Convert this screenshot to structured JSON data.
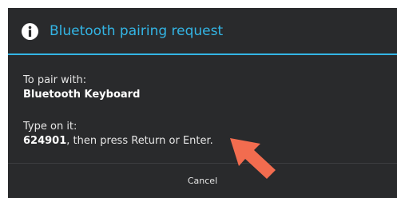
{
  "dialog": {
    "title": "Bluetooth pairing request",
    "icon": "info-icon",
    "pair_label": "To pair with:",
    "device_name": "Bluetooth Keyboard",
    "type_label": "Type on it:",
    "passkey": "624901",
    "instruction": ", then press Return or Enter."
  },
  "buttons": {
    "cancel_label": "Cancel"
  },
  "colors": {
    "accent": "#33b5e5",
    "dialog_background": "#292a2c",
    "pointer_arrow": "#f26c4f"
  }
}
